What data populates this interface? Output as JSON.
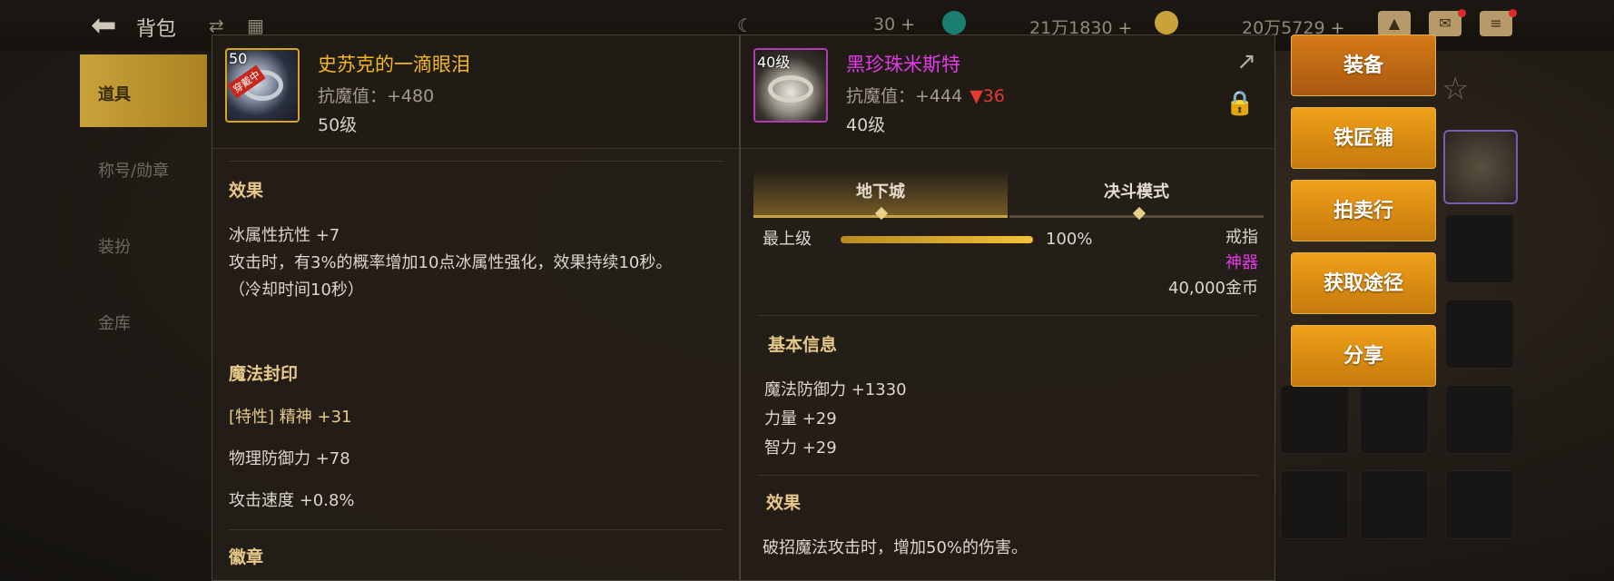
{
  "topbar": {
    "title": "背包",
    "currency1": "30",
    "currency2": "21万1830",
    "currency3": "20万5729"
  },
  "left_tabs": [
    "道具",
    "称号/勋章",
    "装扮",
    "金库"
  ],
  "item_left": {
    "name": "史苏克的一滴眼泪",
    "stat": "抗魔值：+480",
    "level": "50级",
    "badge_level": "50",
    "wear_badge": "穿戴中",
    "sections": {
      "effect_title": "效果",
      "effect_lines": [
        "冰属性抗性 +7",
        "攻击时，有3%的概率增加10点冰属性强化，效果持续10秒。",
        "（冷却时间10秒）"
      ],
      "seal_title": "魔法封印",
      "seal_lines": [
        "[特性] 精神 +31",
        "物理防御力 +78",
        "攻击速度 +0.8%"
      ],
      "emblem_title": "徽章"
    }
  },
  "item_right": {
    "name": "黑珍珠米斯特",
    "stat": "抗魔值：+444",
    "stat_diff": "▼36",
    "level": "40级",
    "badge_level": "40级",
    "tabs": [
      "地下城",
      "决斗模式"
    ],
    "grade_label": "最上级",
    "grade_percent": "100%",
    "grade_value": 1.0,
    "slot_type": "戒指",
    "rarity": "神器",
    "price": "40,000金币",
    "basic_title": "基本信息",
    "basic_lines": [
      "魔法防御力 +1330",
      "力量 +29",
      "智力 +29"
    ],
    "effect_title": "效果",
    "effect_line": "破招魔法攻击时，增加50%的伤害。"
  },
  "actions": [
    "装备",
    "铁匠铺",
    "拍卖行",
    "获取途径",
    "分享"
  ],
  "colors": {
    "legendary_gold": "#f4b81b",
    "epic_pink": "#e23ae8",
    "stat_down": "#e23a30",
    "button_orange": "#e2920f"
  },
  "icons": [
    "back-arrow-icon",
    "share-export-icon",
    "lock-icon",
    "star-icon",
    "mail-icon",
    "chat-icon",
    "shop-icon"
  ]
}
